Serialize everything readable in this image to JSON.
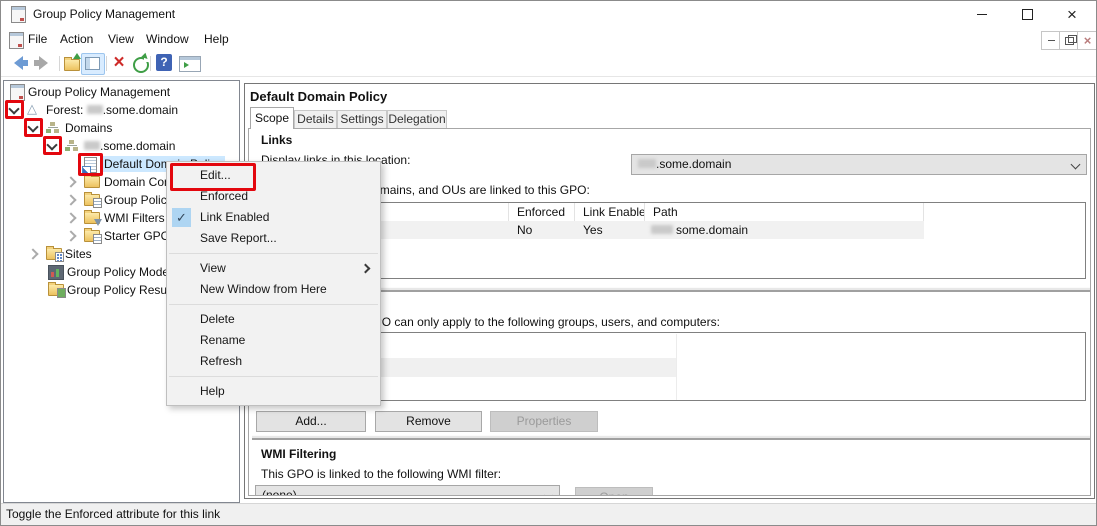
{
  "window": {
    "title": "Group Policy Management"
  },
  "menubar": {
    "items": [
      "File",
      "Action",
      "View",
      "Window",
      "Help"
    ]
  },
  "tree": {
    "items": [
      {
        "label": "Group Policy Management"
      },
      {
        "prefix": "Forest: ",
        "suffix": ".some.domain",
        "redacted": true
      },
      {
        "label": "Domains"
      },
      {
        "prefix": "",
        "suffix": ".some.domain",
        "redacted": true
      },
      {
        "label": "Default Domain Policy",
        "selected": true
      },
      {
        "label": "Domain Controllers"
      },
      {
        "label": "Group Policy Objects"
      },
      {
        "label": "WMI Filters"
      },
      {
        "label": "Starter GPOs"
      },
      {
        "label": "Sites"
      },
      {
        "label": "Group Policy Modeling"
      },
      {
        "label": "Group Policy Results"
      }
    ]
  },
  "context_menu": {
    "items": [
      {
        "label": "Edit...",
        "annotated": true
      },
      {
        "label": "Enforced"
      },
      {
        "label": "Link Enabled",
        "checked": true
      },
      {
        "label": "Save Report..."
      },
      {
        "label": "View",
        "submenu": true
      },
      {
        "label": "New Window from Here"
      },
      {
        "label": "Delete"
      },
      {
        "label": "Rename"
      },
      {
        "label": "Refresh"
      },
      {
        "label": "Help"
      }
    ]
  },
  "content": {
    "title": "Default Domain Policy",
    "tabs": [
      "Scope",
      "Details",
      "Settings",
      "Delegation"
    ],
    "active_tab": "Scope",
    "links": {
      "heading": "Links",
      "display_label": "Display links in this location:",
      "location_suffix": ".some.domain",
      "sentence": "The following sites, domains, and OUs are linked to this GPO:",
      "table": {
        "headers": [
          "",
          "Enforced",
          "Link Enabled",
          "Path"
        ],
        "row": {
          "enforced": "No",
          "link_enabled": "Yes",
          "path_suffix": "some.domain"
        }
      }
    },
    "security": {
      "sentence": "The settings in this GPO can only apply to the following groups, users, and computers:",
      "add_label": "Add...",
      "remove_label": "Remove",
      "properties_label": "Properties"
    },
    "wmi": {
      "heading": "WMI Filtering",
      "sentence": "This GPO is linked to the following WMI filter:",
      "combo_value": "(none)",
      "open_label": "Open"
    }
  },
  "status_bar": {
    "text": "Toggle the Enforced attribute for this link"
  },
  "colors": {
    "annotation_red": "#e3070e",
    "tree_selection": "#cce8ff",
    "menu_check_bg": "#aed5f2",
    "disabled_text": "#9a9a9a"
  }
}
